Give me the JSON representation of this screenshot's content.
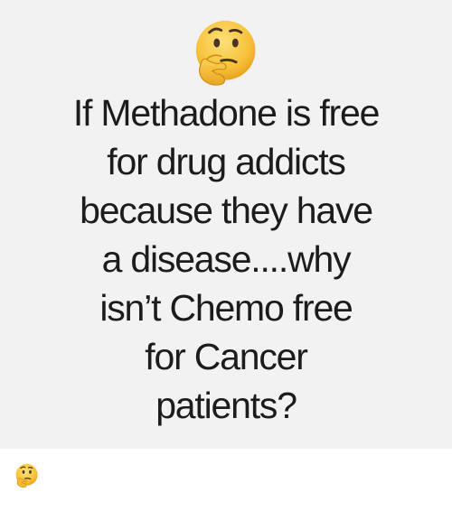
{
  "meme": {
    "lines": [
      "If Methadone is free",
      "for drug addicts",
      "because they have",
      "a disease....why",
      "isn’t Chemo free",
      "for Cancer",
      "patients?"
    ],
    "top_icon": "thinking-face-icon",
    "colors": {
      "card_background": "#f2f2f2",
      "text": "#1c1c1c",
      "emoji_face": "#f7c23a"
    }
  },
  "caption": {
    "icon": "thinking-face-icon"
  }
}
